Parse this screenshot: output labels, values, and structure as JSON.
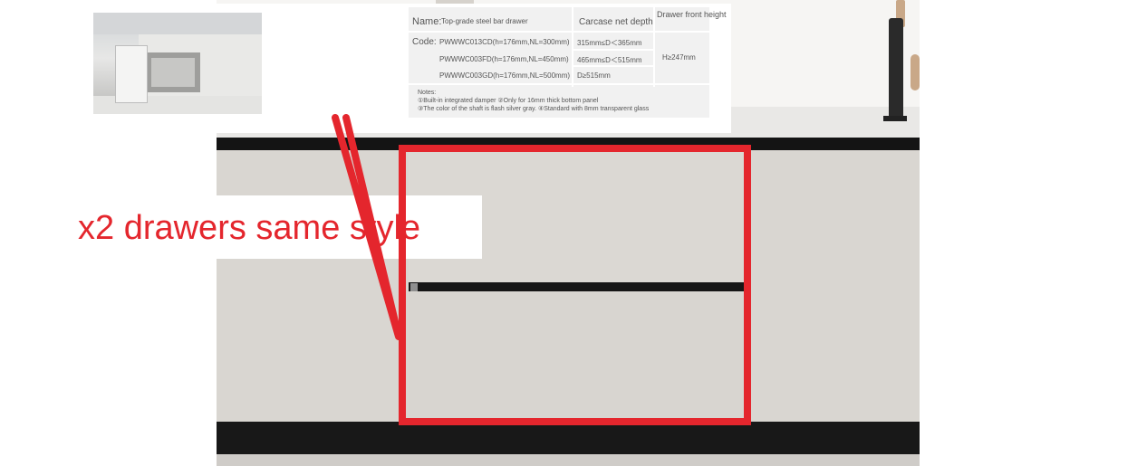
{
  "spec_card": {
    "name_label": "Name:",
    "name_value": "Top-grade steel bar drawer",
    "depth_header": "Carcase net depth",
    "front_header": "Drawer front height",
    "code_label": "Code:",
    "rows": [
      {
        "code": "PWWWC013CD(h=176mm,NL=300mm)",
        "depth": "315mm≤D＜365mm"
      },
      {
        "code": "PWWWC003FD(h=176mm,NL=450mm)",
        "depth": "465mm≤D＜515mm"
      },
      {
        "code": "PWWWC003GD(h=176mm,NL=500mm)",
        "depth": "D≥515mm"
      }
    ],
    "front_value": "H≥247mm",
    "notes": "Notes:\n①Built-in integrated damper ②Only for 16mm thick bottom panel\n③The color of the shaft is flash silver gray. ④Standard with 8mm transparent glass"
  },
  "annotation": {
    "text": "x2 drawers same style",
    "color": "#e4262d"
  }
}
